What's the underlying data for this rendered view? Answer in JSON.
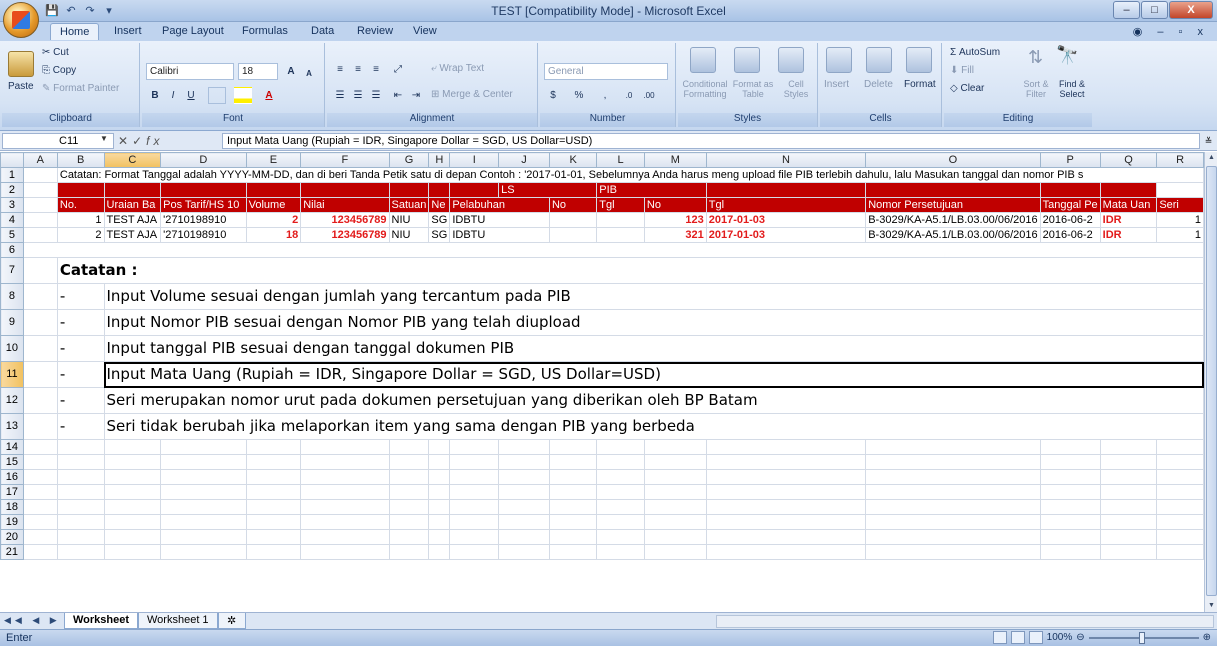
{
  "window": {
    "title": "TEST  [Compatibility Mode] - Microsoft Excel",
    "buttons": {
      "minimize": "–",
      "maximize": "□",
      "close": "X"
    }
  },
  "quick_access": {
    "save": "💾",
    "undo": "↶",
    "redo": "↷",
    "more": "▾"
  },
  "ribbon": {
    "tabs": [
      "Home",
      "Insert",
      "Page Layout",
      "Formulas",
      "Data",
      "Review",
      "View"
    ],
    "active_tab": "Home",
    "right_controls": "◉ – ▫ x",
    "clipboard": {
      "paste": "Paste",
      "cut": "Cut",
      "copy": "Copy",
      "format_painter": "Format Painter",
      "label": "Clipboard"
    },
    "font": {
      "name": "Calibri",
      "size": "18",
      "label": "Font",
      "bold": "B",
      "italic": "I",
      "underline": "U",
      "grow": "A",
      "shrink": "A"
    },
    "alignment": {
      "wrap_text": "Wrap Text",
      "merge_center": "Merge & Center",
      "label": "Alignment"
    },
    "number": {
      "format": "General",
      "label": "Number",
      "percent": "%"
    },
    "styles": {
      "conditional": "Conditional Formatting",
      "format_table": "Format as Table",
      "cell_styles": "Cell Styles",
      "label": "Styles"
    },
    "cells": {
      "insert": "Insert",
      "delete": "Delete",
      "format": "Format",
      "label": "Cells"
    },
    "editing": {
      "autosum": "Σ AutoSum",
      "fill": "Fill",
      "clear": "Clear",
      "sort_filter": "Sort & Filter",
      "find_select": "Find & Select",
      "label": "Editing"
    }
  },
  "formula_bar": {
    "name_box": "C11",
    "fx": "fx",
    "content": "Input Mata Uang (Rupiah = IDR, Singapore Dollar = SGD, US Dollar=USD)"
  },
  "sheet": {
    "columns": [
      "A",
      "B",
      "C",
      "D",
      "E",
      "F",
      "G",
      "H",
      "I",
      "J",
      "K",
      "L",
      "M",
      "N",
      "O",
      "P",
      "Q",
      "R"
    ],
    "rows": [
      "1",
      "2",
      "3",
      "4",
      "5",
      "6",
      "7",
      "8",
      "9",
      "10",
      "11",
      "12",
      "13",
      "14",
      "15",
      "16",
      "17",
      "18",
      "19",
      "20",
      "21"
    ],
    "row1_note": "Catatan: Format Tanggal adalah YYYY-MM-DD, dan di beri Tanda Petik satu di depan Contoh : '2017-01-01, Sebelumnya Anda harus meng upload file PIB terlebih dahulu, lalu Masukan tanggal dan nomor PIB s",
    "row2": {
      "ls": "LS",
      "pib": "PIB"
    },
    "headers": [
      "No.",
      "Uraian Ba",
      "Pos Tarif/HS 10",
      "Volume",
      "Nilai",
      "Satuan",
      "Ne",
      "Pelabuhan",
      "No",
      "Tgl",
      "No",
      "Tgl",
      "Nomor Persetujuan",
      "Tanggal Pe",
      "Mata Uan",
      "Seri"
    ],
    "data_rows": [
      [
        "1",
        "TEST AJA",
        "'2710198910",
        "2",
        "123456789",
        "NIU",
        "SG",
        "IDBTU",
        "",
        "",
        "123",
        "2017-01-03",
        "B-3029/KA-A5.1/LB.03.00/06/2016",
        "2016-06-2",
        "IDR",
        "1"
      ],
      [
        "2",
        "TEST AJA",
        "'2710198910",
        "18",
        "123456789",
        "NIU",
        "SG",
        "IDBTU",
        "",
        "",
        "321",
        "2017-01-03",
        "B-3029/KA-A5.1/LB.03.00/06/2016",
        "2016-06-2",
        "IDR",
        "1"
      ]
    ],
    "catatan_title": "Catatan :",
    "notes": [
      {
        "dash": "-",
        "text": "Input Volume sesuai dengan jumlah yang tercantum pada PIB"
      },
      {
        "dash": "-",
        "text": "Input Nomor PIB sesuai dengan Nomor PIB yang telah diupload"
      },
      {
        "dash": "-",
        "text": "Input tanggal PIB sesuai dengan tanggal dokumen PIB"
      },
      {
        "dash": "-",
        "text": "Input Mata Uang (Rupiah = IDR, Singapore Dollar = SGD, US Dollar=USD)"
      },
      {
        "dash": "-",
        "text": "Seri merupakan nomor urut pada dokumen persetujuan yang diberikan oleh BP Batam"
      },
      {
        "dash": "-",
        "text": "Seri tidak berubah jika melaporkan item yang sama dengan PIB yang berbeda"
      }
    ]
  },
  "sheet_tabs": {
    "nav": "◀◀ ◀ ▶ ▶▶",
    "tabs": [
      "Worksheet",
      "Worksheet 1"
    ],
    "active": "Worksheet"
  },
  "status_bar": {
    "mode": "Enter",
    "zoom": "100%"
  }
}
